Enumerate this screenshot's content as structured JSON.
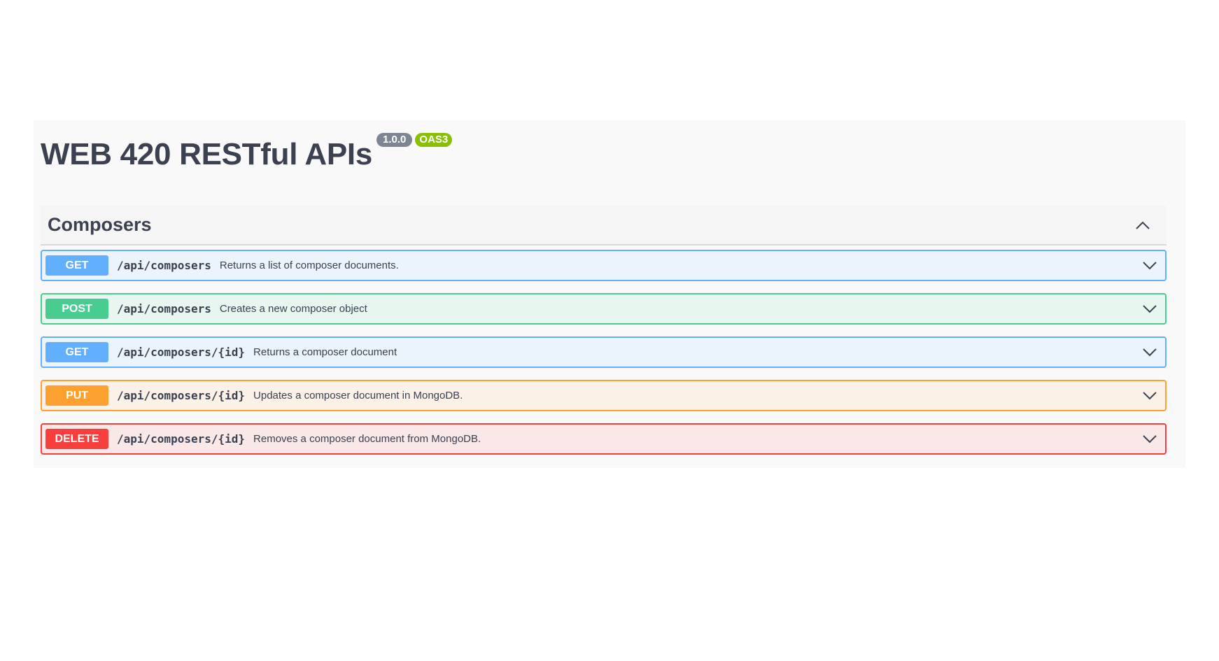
{
  "info": {
    "title": "WEB 420 RESTful APIs",
    "version": "1.0.0",
    "spec_badge": "OAS3"
  },
  "colors": {
    "get": "#61affe",
    "post": "#49cc90",
    "put": "#fca130",
    "delete": "#f93e3e",
    "version_badge": "#7d8492",
    "oas_badge": "#89bf04"
  },
  "tag": {
    "name": "Composers",
    "toggle_icon": "chevron-up-icon"
  },
  "operations": [
    {
      "method": "GET",
      "path": "/api/composers",
      "summary": "Returns a list of composer documents.",
      "icon": "chevron-down-icon"
    },
    {
      "method": "POST",
      "path": "/api/composers",
      "summary": "Creates a new composer object",
      "icon": "chevron-down-icon"
    },
    {
      "method": "GET",
      "path": "/api/composers/{id}",
      "summary": "Returns a composer document",
      "icon": "chevron-down-icon"
    },
    {
      "method": "PUT",
      "path": "/api/composers/{id}",
      "summary": "Updates a composer document in MongoDB.",
      "icon": "chevron-down-icon"
    },
    {
      "method": "DELETE",
      "path": "/api/composers/{id}",
      "summary": "Removes a composer document from MongoDB.",
      "icon": "chevron-down-icon"
    }
  ]
}
